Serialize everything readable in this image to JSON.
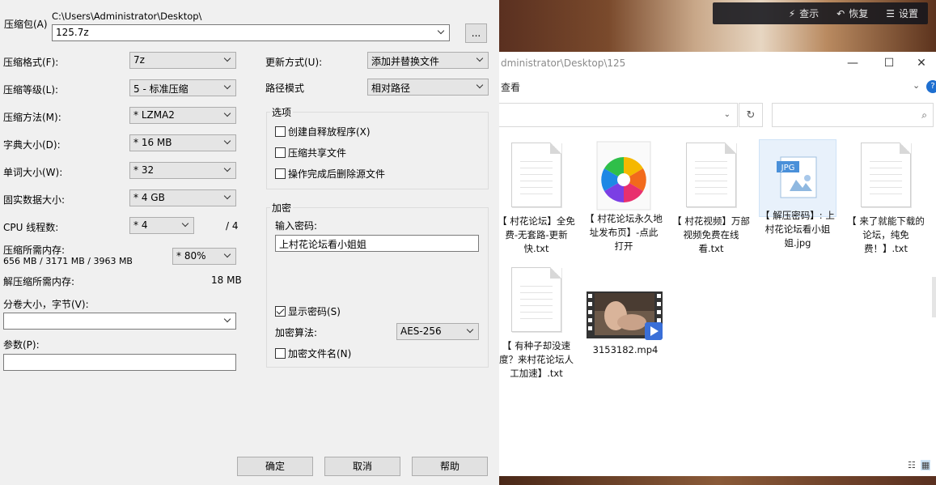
{
  "dialog": {
    "archive_label": "压缩包(A)",
    "archive_path": "C:\\Users\\Administrator\\Desktop\\",
    "archive_name": "125.7z",
    "browse_label": "...",
    "left": {
      "format_label": "压缩格式(F):",
      "format_value": "7z",
      "level_label": "压缩等级(L):",
      "level_value": "5 - 标准压缩",
      "method_label": "压缩方法(M):",
      "method_value": "* LZMA2",
      "dict_label": "字典大小(D):",
      "dict_value": "* 16 MB",
      "word_label": "单词大小(W):",
      "word_value": "* 32",
      "solid_label": "固实数据大小:",
      "solid_value": "* 4 GB",
      "threads_label": "CPU 线程数:",
      "threads_value": "* 4",
      "threads_max": "/ 4",
      "mem_label": "压缩所需内存:",
      "mem_detail": "656 MB / 3171 MB / 3963 MB",
      "mem_value": "* 80%",
      "decomp_label": "解压缩所需内存:",
      "decomp_value": "18 MB",
      "split_label": "分卷大小，字节(V):",
      "split_value": "",
      "params_label": "参数(P):",
      "params_value": ""
    },
    "right": {
      "update_label": "更新方式(U):",
      "update_value": "添加并替换文件",
      "pathmode_label": "路径模式",
      "pathmode_value": "相对路径",
      "options_title": "选项",
      "opt_sfx": "创建自释放程序(X)",
      "opt_shared": "压缩共享文件",
      "opt_delete": "操作完成后删除源文件",
      "encrypt_title": "加密",
      "password_label": "输入密码:",
      "password_value": "上村花论坛看小姐姐",
      "show_password": "显示密码(S)",
      "enc_method_label": "加密算法:",
      "enc_method_value": "AES-256",
      "enc_names": "加密文件名(N)"
    },
    "buttons": {
      "ok": "确定",
      "cancel": "取消",
      "help": "帮助"
    }
  },
  "desktop": {
    "restore_bar": {
      "view": "查示",
      "restore": "恢复",
      "settings": "设置"
    }
  },
  "explorer": {
    "title_path": "dministrator\\Desktop\\125",
    "ribbon_tab": "查看",
    "help": "?",
    "files": [
      {
        "name": "【 村花论坛】全免费-无套路-更新快.txt",
        "type": "txt"
      },
      {
        "name": "【 村花论坛永久地址发布页】-点此打开",
        "type": "link"
      },
      {
        "name": "【 村花视频】万部视频免费在线看.txt",
        "type": "txt"
      },
      {
        "name": "【 解压密码】: 上村花论坛看小姐姐.jpg",
        "type": "jpg"
      },
      {
        "name": "【 来了就能下载的论坛，纯免费！】.txt",
        "type": "txt"
      },
      {
        "name": "【 有种子却没速度？来村花论坛人工加速】.txt",
        "type": "txt"
      },
      {
        "name": "3153182.mp4",
        "type": "video"
      }
    ]
  }
}
